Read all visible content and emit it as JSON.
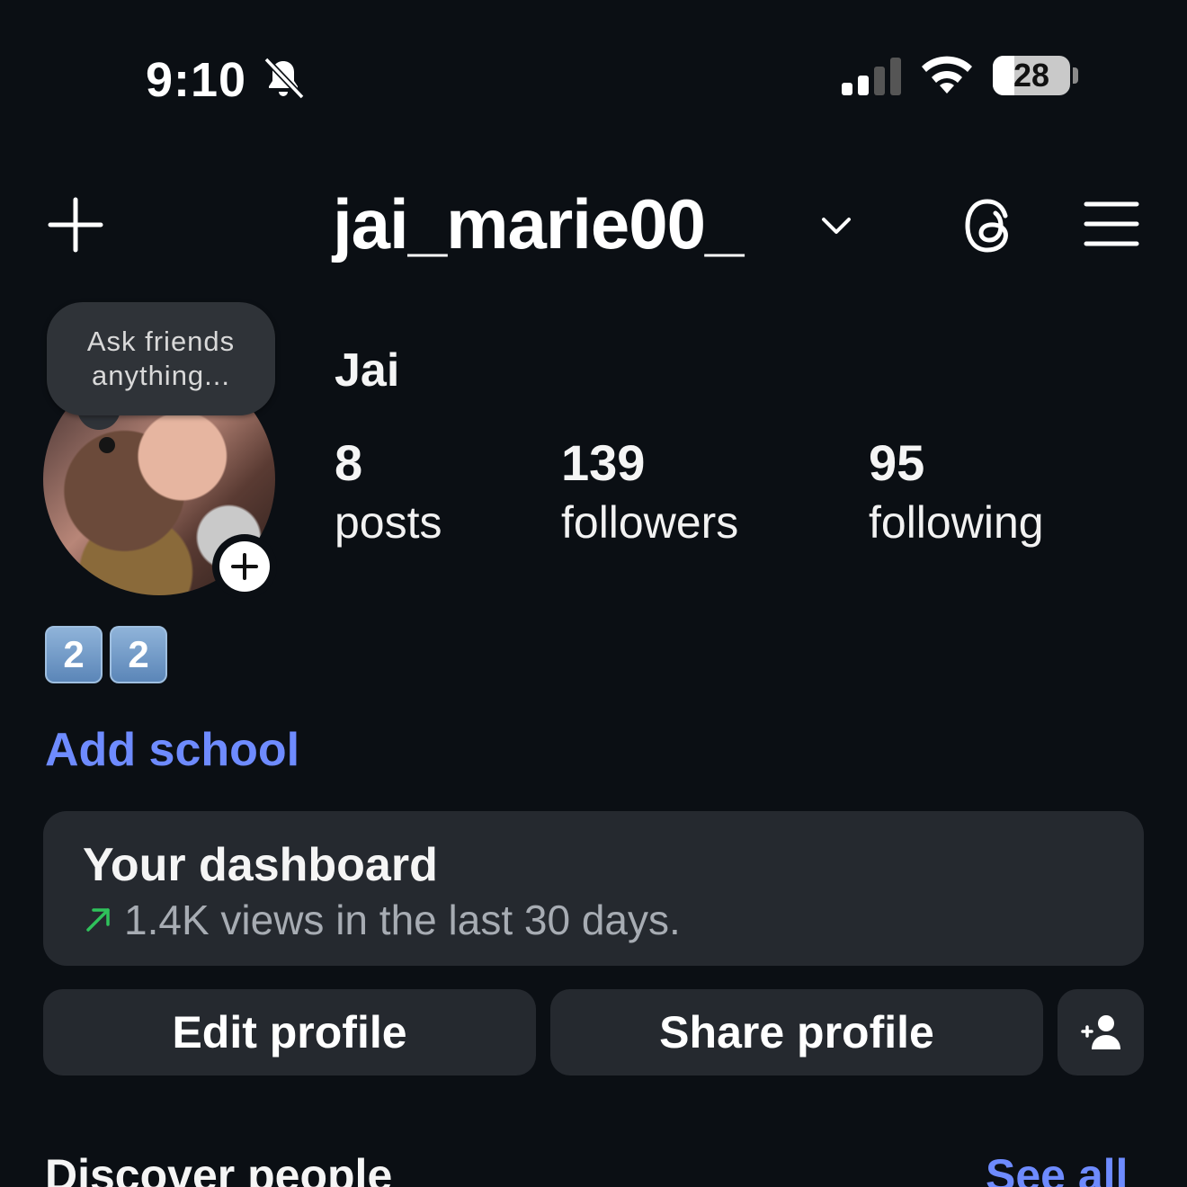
{
  "status_bar": {
    "time": "9:10",
    "battery": "28",
    "icons": [
      "bell-slash-icon",
      "cellular-signal-icon",
      "wifi-icon",
      "battery-icon"
    ]
  },
  "header": {
    "username": "jai_marie00_",
    "icons": [
      "plus-icon",
      "chevron-down-icon",
      "threads-icon",
      "menu-icon"
    ]
  },
  "profile": {
    "note_bubble_line1": "Ask friends",
    "note_bubble_line2": "anything...",
    "display_name": "Jai",
    "stats": {
      "posts_count": "8",
      "posts_label": "posts",
      "followers_count": "139",
      "followers_label": "followers",
      "following_count": "95",
      "following_label": "following"
    },
    "bio_keycaps": [
      "2",
      "2"
    ],
    "add_school": "Add school"
  },
  "dashboard": {
    "title": "Your dashboard",
    "subtitle": "1.4K views in the last 30 days."
  },
  "actions": {
    "edit_profile": "Edit profile",
    "share_profile": "Share profile"
  },
  "discover": {
    "title": "Discover people",
    "see_all": "See all"
  },
  "colors": {
    "background": "#0b0f14",
    "card": "#25292f",
    "link": "#6e8bff",
    "trend_arrow": "#2fc25b"
  }
}
